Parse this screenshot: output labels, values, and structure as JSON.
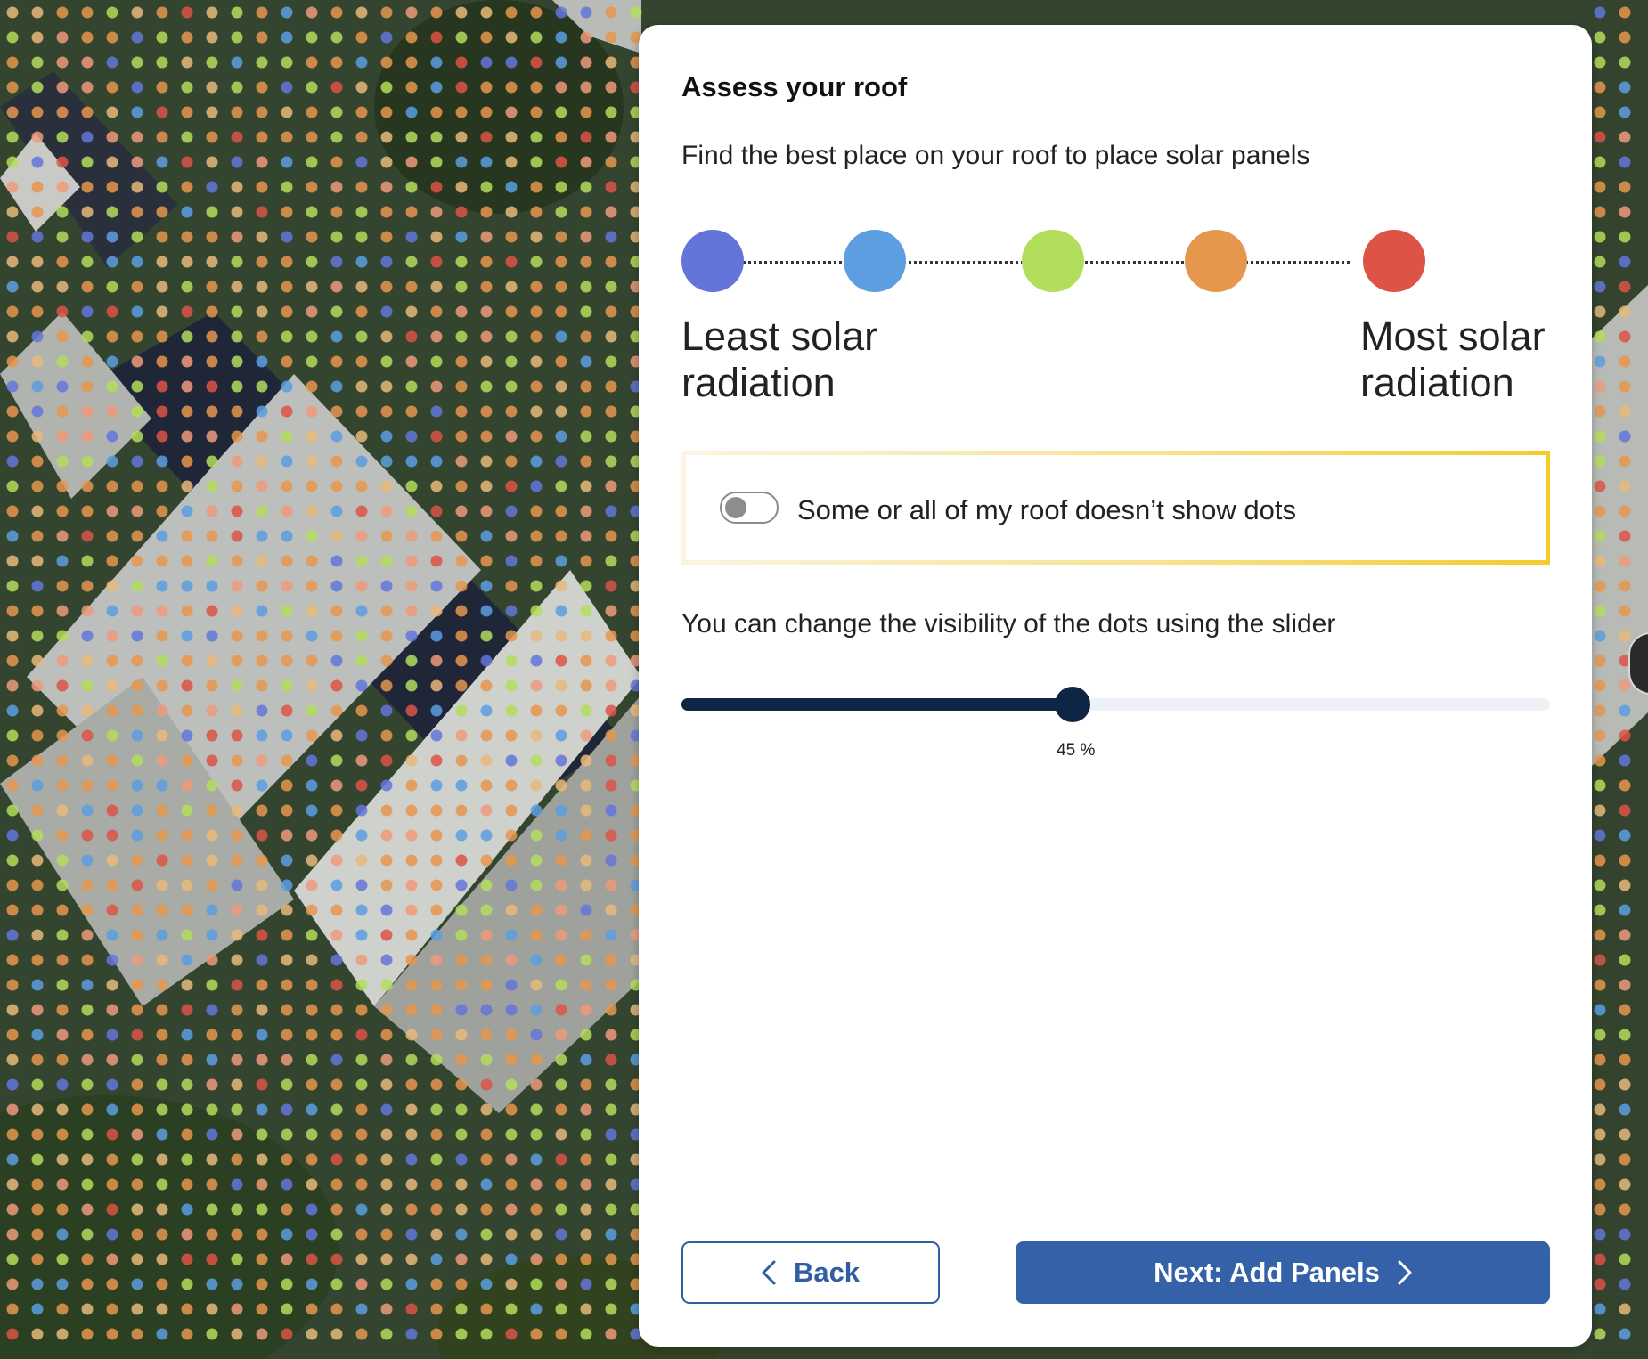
{
  "panel": {
    "title": "Assess your roof",
    "subtitle": "Find the best place on your roof to place solar panels"
  },
  "legend": {
    "colors": [
      "#6475d9",
      "#5c9ee0",
      "#b3dd5c",
      "#e6974e",
      "#dd5346"
    ],
    "least_label": "Least solar radiation",
    "most_label": "Most solar radiation"
  },
  "toggle": {
    "label": "Some or all of my roof doesn’t show dots",
    "checked": false
  },
  "slider": {
    "hint": "You can change the visibility of the dots using the slider",
    "value_percent": 45,
    "value_label": "45 %"
  },
  "buttons": {
    "back_label": "Back",
    "next_label": "Next: Add Panels"
  },
  "colors": {
    "primary": "#3461a7",
    "slider_dark": "#0f2545",
    "highlight": "#f3cc2c"
  },
  "icons": {
    "back": "chevron-left-icon",
    "next": "chevron-right-icon"
  }
}
